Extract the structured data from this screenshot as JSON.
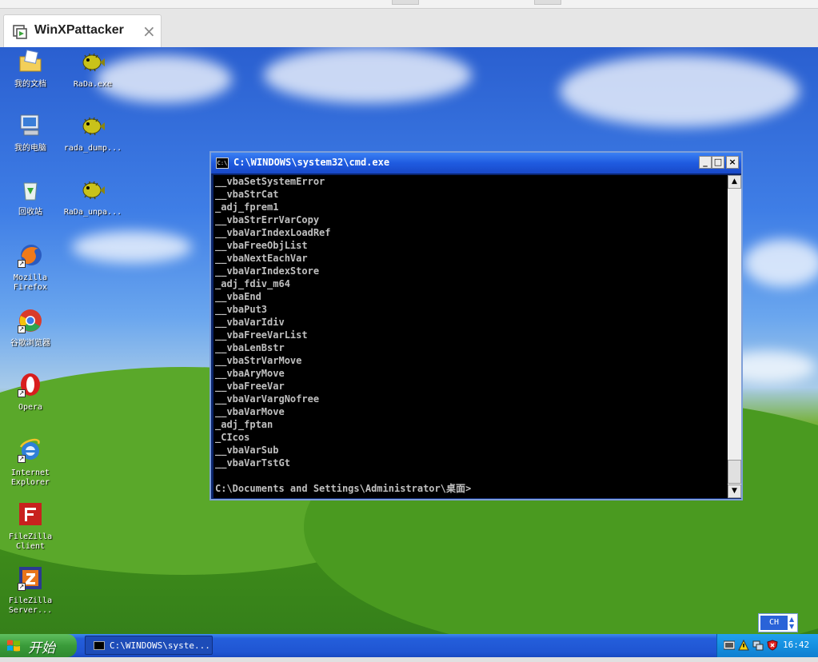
{
  "host": {
    "tab_title": "WinXPattacker",
    "tab_close": "×"
  },
  "desktop": {
    "icons": [
      {
        "name": "my-documents",
        "label": "我的文档"
      },
      {
        "name": "rada-exe",
        "label": "RaDa.exe"
      },
      {
        "name": "my-computer",
        "label": "我的电脑"
      },
      {
        "name": "rada-dump",
        "label": "rada_dump..."
      },
      {
        "name": "recycle-bin",
        "label": "回收站"
      },
      {
        "name": "rada-unpacked",
        "label": "RaDa_unpa..."
      },
      {
        "name": "mozilla-firefox",
        "label": "Mozilla\nFirefox"
      },
      {
        "name": "google-chrome",
        "label": "谷歌浏览器"
      },
      {
        "name": "opera",
        "label": "Opera"
      },
      {
        "name": "internet-explorer",
        "label": "Internet\nExplorer"
      },
      {
        "name": "filezilla-client",
        "label": "FileZilla\nClient"
      },
      {
        "name": "filezilla-server",
        "label": "FileZilla\nServer..."
      }
    ]
  },
  "cmd": {
    "title": "C:\\WINDOWS\\system32\\cmd.exe",
    "icon_text": "C:\\",
    "minimize": "_",
    "maximize": "□",
    "close": "×",
    "lines": [
      "__vbaSetSystemError",
      "__vbaStrCat",
      "_adj_fprem1",
      "__vbaStrErrVarCopy",
      "__vbaVarIndexLoadRef",
      "__vbaFreeObjList",
      "__vbaNextEachVar",
      "__vbaVarIndexStore",
      "_adj_fdiv_m64",
      "__vbaEnd",
      "__vbaPut3",
      "__vbaVarIdiv",
      "__vbaFreeVarList",
      "__vbaLenBstr",
      "__vbaStrVarMove",
      "__vbaAryMove",
      "__vbaFreeVar",
      "__vbaVarVargNofree",
      "__vbaVarMove",
      "_adj_fptan",
      "_CIcos",
      "__vbaVarSub",
      "__vbaVarTstGt"
    ],
    "prompt": "C:\\Documents and Settings\\Administrator\\桌面>",
    "scroll_up": "▲",
    "scroll_down": "▼"
  },
  "taskbar": {
    "start_label": "开始",
    "task_label": "C:\\WINDOWS\\syste...",
    "clock": "16:42",
    "lang": "CH"
  }
}
